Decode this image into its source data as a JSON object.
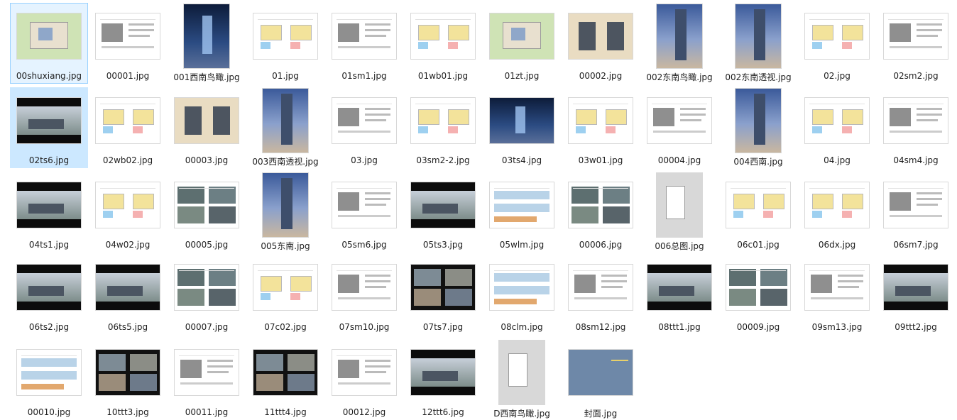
{
  "files": [
    {
      "name": "00shuxiang.jpg",
      "kind": "site",
      "state": "focus"
    },
    {
      "name": "00001.jpg",
      "kind": "doc"
    },
    {
      "name": "001西南鸟瞰.jpg",
      "kind": "sky"
    },
    {
      "name": "01.jpg",
      "kind": "plans"
    },
    {
      "name": "01sm1.jpg",
      "kind": "doc"
    },
    {
      "name": "01wb01.jpg",
      "kind": "plans"
    },
    {
      "name": "01zt.jpg",
      "kind": "site"
    },
    {
      "name": "00002.jpg",
      "kind": "beige"
    },
    {
      "name": "002东南鸟瞰.jpg",
      "kind": "tower"
    },
    {
      "name": "002东南透视.jpg",
      "kind": "tower"
    },
    {
      "name": "02.jpg",
      "kind": "plans"
    },
    {
      "name": "02sm2.jpg",
      "kind": "doc"
    },
    {
      "name": "02ts6.jpg",
      "kind": "band",
      "state": "selected"
    },
    {
      "name": "02wb02.jpg",
      "kind": "plans"
    },
    {
      "name": "00003.jpg",
      "kind": "beige"
    },
    {
      "name": "003西南透视.jpg",
      "kind": "tower"
    },
    {
      "name": "03.jpg",
      "kind": "doc"
    },
    {
      "name": "03sm2-2.jpg",
      "kind": "plans"
    },
    {
      "name": "03ts4.jpg",
      "kind": "sky"
    },
    {
      "name": "03w01.jpg",
      "kind": "plans"
    },
    {
      "name": "00004.jpg",
      "kind": "doc"
    },
    {
      "name": "004西南.jpg",
      "kind": "tower"
    },
    {
      "name": "04.jpg",
      "kind": "plans"
    },
    {
      "name": "04sm4.jpg",
      "kind": "doc"
    },
    {
      "name": "04ts1.jpg",
      "kind": "band"
    },
    {
      "name": "04w02.jpg",
      "kind": "plans"
    },
    {
      "name": "00005.jpg",
      "kind": "photos"
    },
    {
      "name": "005东南.jpg",
      "kind": "tower"
    },
    {
      "name": "05sm6.jpg",
      "kind": "doc"
    },
    {
      "name": "05ts3.jpg",
      "kind": "band"
    },
    {
      "name": "05wlm.jpg",
      "kind": "elev"
    },
    {
      "name": "00006.jpg",
      "kind": "photos"
    },
    {
      "name": "006总图.jpg",
      "kind": "grey"
    },
    {
      "name": "06c01.jpg",
      "kind": "plans"
    },
    {
      "name": "06dx.jpg",
      "kind": "plans"
    },
    {
      "name": "06sm7.jpg",
      "kind": "doc"
    },
    {
      "name": "06ts2.jpg",
      "kind": "band"
    },
    {
      "name": "06ts5.jpg",
      "kind": "band"
    },
    {
      "name": "00007.jpg",
      "kind": "photos"
    },
    {
      "name": "07c02.jpg",
      "kind": "plans"
    },
    {
      "name": "07sm10.jpg",
      "kind": "doc"
    },
    {
      "name": "07ts7.jpg",
      "kind": "dark"
    },
    {
      "name": "08clm.jpg",
      "kind": "elev"
    },
    {
      "name": "08sm12.jpg",
      "kind": "doc"
    },
    {
      "name": "08ttt1.jpg",
      "kind": "band"
    },
    {
      "name": "00009.jpg",
      "kind": "photos"
    },
    {
      "name": "09sm13.jpg",
      "kind": "doc"
    },
    {
      "name": "09ttt2.jpg",
      "kind": "band"
    },
    {
      "name": "00010.jpg",
      "kind": "elev"
    },
    {
      "name": "10ttt3.jpg",
      "kind": "dark"
    },
    {
      "name": "00011.jpg",
      "kind": "doc"
    },
    {
      "name": "11ttt4.jpg",
      "kind": "dark"
    },
    {
      "name": "00012.jpg",
      "kind": "doc"
    },
    {
      "name": "12ttt6.jpg",
      "kind": "band"
    },
    {
      "name": "D西南鸟瞰.jpg",
      "kind": "grey"
    },
    {
      "name": "封面.jpg",
      "kind": "slate"
    }
  ]
}
